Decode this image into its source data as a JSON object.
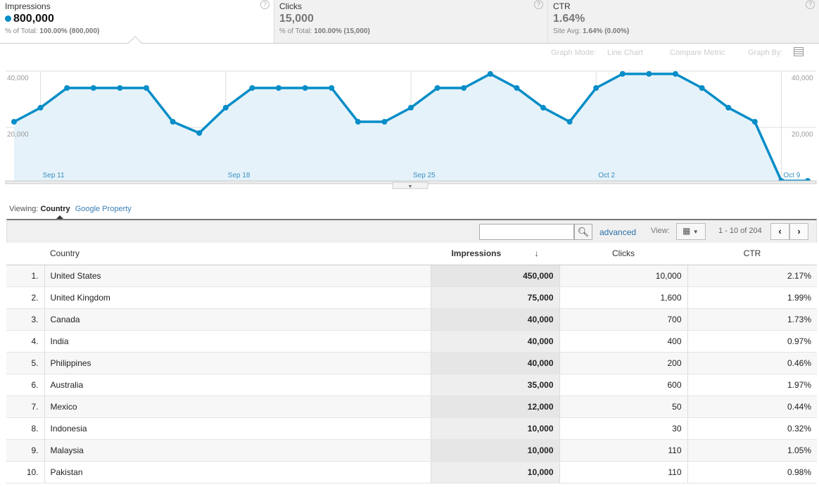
{
  "metrics": [
    {
      "label": "Impressions",
      "value": "800,000",
      "sub_label": "% of Total:",
      "sub_value": "100.00% (800,000)",
      "active": true
    },
    {
      "label": "Clicks",
      "value": "15,000",
      "sub_label": "% of Total:",
      "sub_value": "100.00% (15,000)"
    },
    {
      "label": "CTR",
      "value": "1.64%",
      "sub_label": "Site Avg:",
      "sub_value": "1.64% (0.00%)"
    }
  ],
  "help_icon": "?",
  "graph_options": {
    "mode_label": "Graph Mode:",
    "mode_value": "Line Chart",
    "compare": "Compare Metric",
    "graph_by": "Graph By:"
  },
  "chart_data": {
    "type": "area",
    "x": [
      "Sep 10",
      "Sep 11",
      "Sep 12",
      "Sep 13",
      "Sep 14",
      "Sep 15",
      "Sep 16",
      "Sep 17",
      "Sep 18",
      "Sep 19",
      "Sep 20",
      "Sep 21",
      "Sep 22",
      "Sep 23",
      "Sep 24",
      "Sep 25",
      "Sep 26",
      "Sep 27",
      "Sep 28",
      "Sep 29",
      "Sep 30",
      "Oct 1",
      "Oct 2",
      "Oct 3",
      "Oct 4",
      "Oct 5",
      "Oct 6",
      "Oct 7",
      "Oct 8",
      "Oct 9",
      "Oct 10"
    ],
    "series": [
      {
        "name": "Impressions",
        "values": [
          22000,
          27000,
          34000,
          34000,
          34000,
          34000,
          22000,
          18000,
          27000,
          34000,
          34000,
          34000,
          34000,
          22000,
          22000,
          27000,
          34000,
          34000,
          39000,
          34000,
          27000,
          22000,
          34000,
          39000,
          39000,
          39000,
          34000,
          27000,
          22000,
          0,
          0
        ]
      }
    ],
    "x_tick_labels": [
      "Sep 11",
      "Sep 18",
      "Sep 25",
      "Oct 2",
      "Oct 9"
    ],
    "y_tick_labels": [
      "40,000",
      "20,000"
    ],
    "ylim": [
      0,
      40000
    ],
    "color": "#058dc7",
    "grid": true
  },
  "viewing": {
    "label": "Viewing:",
    "active": "Country",
    "other": "Google Property"
  },
  "toolbar": {
    "search_placeholder": "",
    "advanced": "advanced",
    "view_label": "View:",
    "pagination": "1 - 10 of 204",
    "prev": "‹",
    "next": "›"
  },
  "table": {
    "headers": [
      "Country",
      "Impressions",
      "Clicks",
      "CTR"
    ],
    "sort_indicator": "↓",
    "rows": [
      [
        "1.",
        "United States",
        "450,000",
        "10,000",
        "2.17%"
      ],
      [
        "2.",
        "United Kingdom",
        "75,000",
        "1,600",
        "1.99%"
      ],
      [
        "3.",
        "Canada",
        "40,000",
        "700",
        "1.73%"
      ],
      [
        "4.",
        "India",
        "40,000",
        "400",
        "0.97%"
      ],
      [
        "5.",
        "Philippines",
        "40,000",
        "200",
        "0.46%"
      ],
      [
        "6.",
        "Australia",
        "35,000",
        "600",
        "1.97%"
      ],
      [
        "7.",
        "Mexico",
        "12,000",
        "50",
        "0.44%"
      ],
      [
        "8.",
        "Indonesia",
        "10,000",
        "30",
        "0.32%"
      ],
      [
        "9.",
        "Malaysia",
        "10,000",
        "110",
        "1.05%"
      ],
      [
        "10.",
        "Pakistan",
        "10,000",
        "110",
        "0.98%"
      ]
    ]
  }
}
